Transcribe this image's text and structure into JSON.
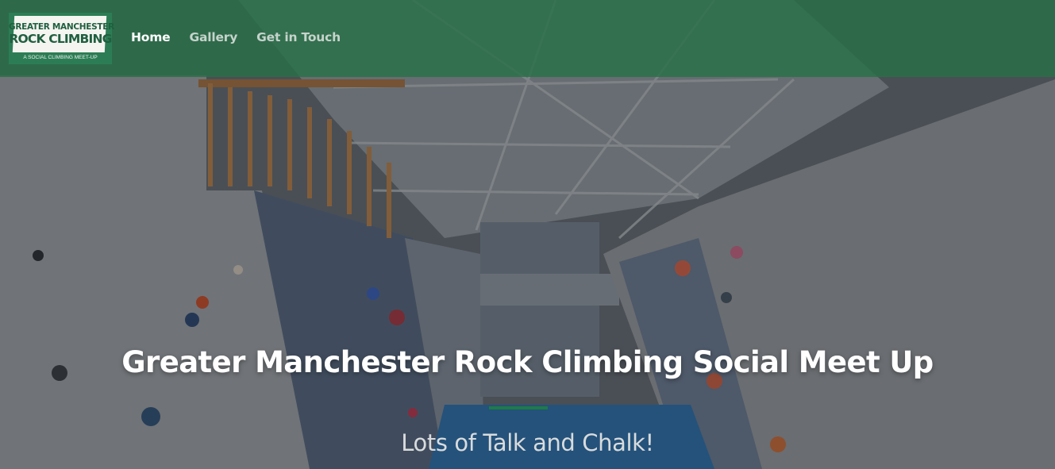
{
  "brand": {
    "logo_line1": "GREATER MANCHESTER",
    "logo_line2": "ROCK CLIMBING",
    "logo_tagline": "A SOCIAL CLIMBING MEET-UP"
  },
  "nav": {
    "items": [
      {
        "label": "Home",
        "active": true
      },
      {
        "label": "Gallery",
        "active": false
      },
      {
        "label": "Get in Touch",
        "active": false
      }
    ]
  },
  "hero": {
    "title": "Greater Manchester Rock Climbing Social Meet Up",
    "subtitle": "Lots of Talk and Chalk!"
  },
  "colors": {
    "header": "#287048",
    "logo_bg": "#2c7d55",
    "accent": "#1e7a4a",
    "text": "#ffffff"
  }
}
